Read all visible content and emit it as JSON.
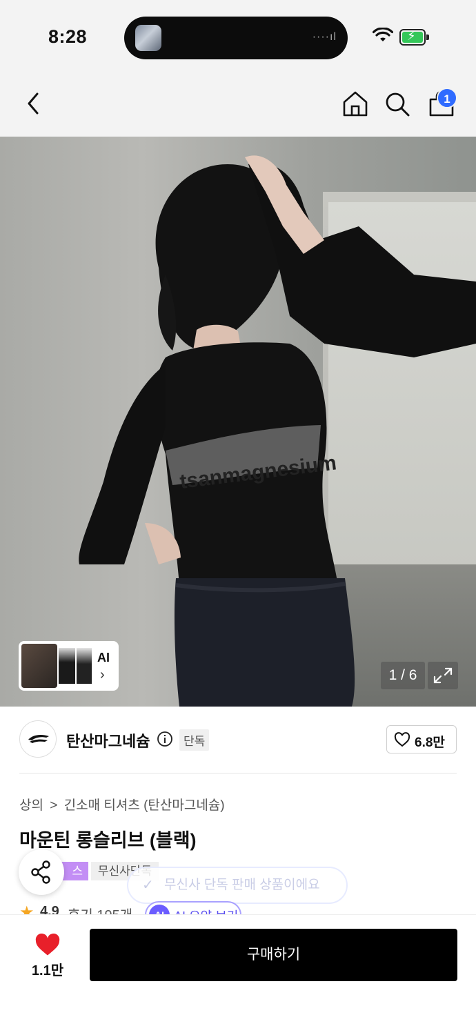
{
  "status_bar": {
    "time": "8:28",
    "icons": [
      "wifi-icon",
      "battery-charging-icon"
    ]
  },
  "nav": {
    "cart_count": "1",
    "icons": [
      "back-icon",
      "home-icon",
      "search-icon",
      "cart-icon"
    ]
  },
  "gallery": {
    "thumb_label": "AI",
    "page_counter": "1 / 6"
  },
  "brand": {
    "name": "탄산마그네슘",
    "exclusive_tag": "단독",
    "likes": "6.8만"
  },
  "product": {
    "breadcrumb": [
      "상의",
      ">",
      "긴소매 티셔츠 (탄산마그네슘)"
    ],
    "title": "마운틴 롱슬리브 (블랙)",
    "badge_purple": "스타",
    "badge_gray": "무신사단독",
    "toast": "무신사 단독 판매 상품이에요",
    "rating": "4.9",
    "reviews": "후기 195개",
    "ai_badge": "AI",
    "ai_summary": "AI 요약 보기"
  },
  "bottom_bar": {
    "wish_count": "1.1만",
    "buy_label": "구매하기"
  },
  "colors": {
    "accent_blue": "#2f6bff",
    "heart_red": "#e8202a",
    "badge_purple": "#c38ef5",
    "button_black": "#000000"
  }
}
